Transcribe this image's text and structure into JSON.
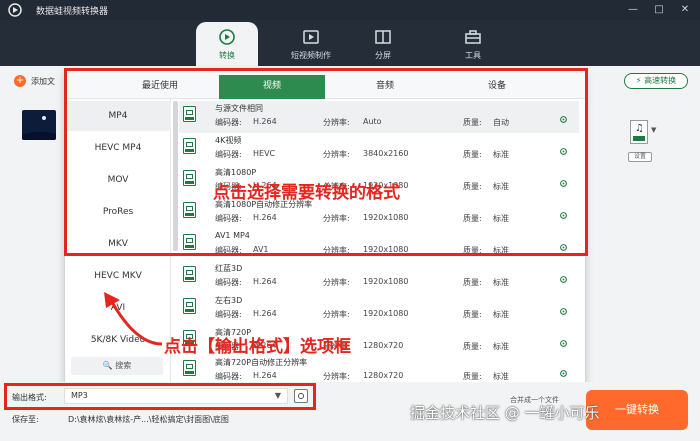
{
  "window": {
    "title": "数据蛙视频转换器",
    "controls": [
      "minimize-icon",
      "restore-icon",
      "close-icon"
    ]
  },
  "topnav": {
    "tabs": [
      {
        "label": "转换",
        "icon": "convert-icon",
        "active": true
      },
      {
        "label": "短视频制作",
        "icon": "video-make-icon",
        "active": false
      },
      {
        "label": "分屏",
        "icon": "split-screen-icon",
        "active": false
      },
      {
        "label": "工具",
        "icon": "toolbox-icon",
        "active": false
      }
    ]
  },
  "toolbar": {
    "add_file_label": "添加文",
    "fast_convert_label": "高速转换"
  },
  "side": {
    "settings_label": "设置"
  },
  "popup": {
    "tabs": [
      {
        "label": "最近使用",
        "active": false
      },
      {
        "label": "视频",
        "active": true
      },
      {
        "label": "音频",
        "active": false
      },
      {
        "label": "设备",
        "active": false
      }
    ],
    "formats": [
      "MP4",
      "HEVC MP4",
      "MOV",
      "ProRes",
      "MKV",
      "HEVC MKV",
      "AVI",
      "5K/8K Video"
    ],
    "selected_format": "MP4",
    "search_label": "搜索",
    "encoder_label": "编码器:",
    "resolution_label": "分辨率:",
    "quality_label": "质量:",
    "presets": [
      {
        "name": "与源文件相同",
        "encoder": "H.264",
        "resolution": "Auto",
        "quality": "自动",
        "icon": "same-as-source-icon"
      },
      {
        "name": "4K视频",
        "encoder": "HEVC",
        "resolution": "3840x2160",
        "quality": "标准",
        "icon": "4k-icon"
      },
      {
        "name": "高清1080P",
        "encoder": "H.264",
        "resolution": "1920x1080",
        "quality": "标准",
        "icon": "hd-1080p-icon"
      },
      {
        "name": "高清1080P自动修正分辨率",
        "encoder": "H.264",
        "resolution": "1920x1080",
        "quality": "标准",
        "icon": "hd-1080p-auto-icon"
      },
      {
        "name": "AV1 MP4",
        "encoder": "AV1",
        "resolution": "1920x1080",
        "quality": "标准",
        "icon": "av1-icon"
      },
      {
        "name": "红蓝3D",
        "encoder": "H.264",
        "resolution": "1920x1080",
        "quality": "标准",
        "icon": "3d-red-blue-icon"
      },
      {
        "name": "左右3D",
        "encoder": "H.264",
        "resolution": "1920x1080",
        "quality": "标准",
        "icon": "3d-left-right-icon"
      },
      {
        "name": "高清720P",
        "encoder": "H.264",
        "resolution": "1280x720",
        "quality": "标准",
        "icon": "hd-720p-icon"
      },
      {
        "name": "高清720P自动修正分辨率",
        "encoder": "H.264",
        "resolution": "1280x720",
        "quality": "标准",
        "icon": "hd-720p-auto-icon"
      }
    ]
  },
  "bottom": {
    "output_format_label": "输出格式:",
    "output_format_value": "MP3",
    "save_to_label": "保存至:",
    "save_path": "D:\\袁林炫\\袁林炫-产...\\轻松搞定\\封面图\\底图",
    "merge_label": "合并成一个文件",
    "convert_all_label": "一键转换"
  },
  "annotations": {
    "select_format_text": "点击选择需要转换的格式",
    "click_output_text": "点击【输出格式】选项框",
    "watermark": "掘金技术社区 @ 一罐小可乐",
    "color": "#e3261f"
  },
  "colors": {
    "brand_green": "#2e8b4f",
    "accent_orange": "#ff6a2c",
    "titlebar_bg": "#222a35"
  }
}
